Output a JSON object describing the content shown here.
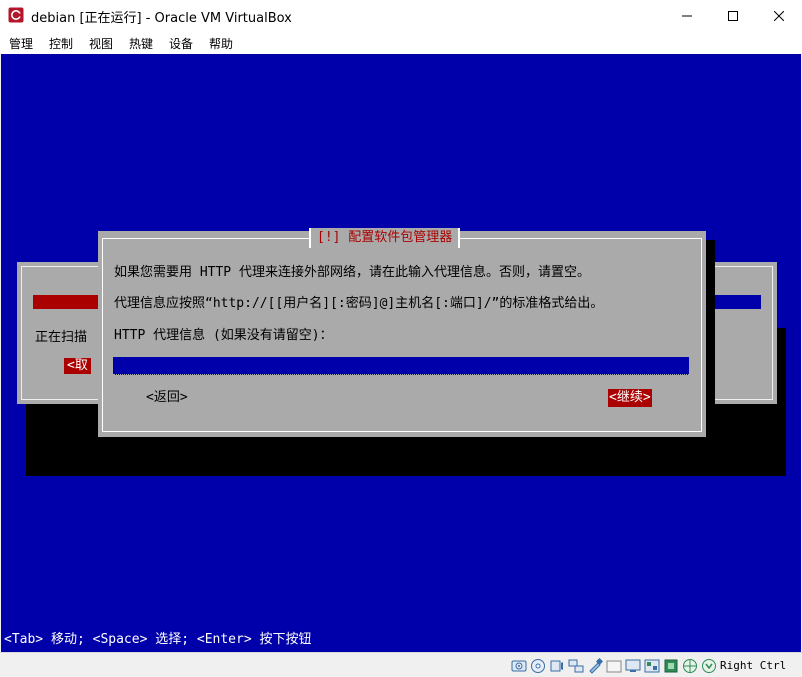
{
  "window": {
    "title": "debian [正在运行] - Oracle VM VirtualBox",
    "host_key": "Right Ctrl"
  },
  "menu": [
    "管理",
    "控制",
    "视图",
    "热键",
    "设备",
    "帮助"
  ],
  "background_dialog": {
    "status_text": "正在扫描",
    "cancel_label": "<取"
  },
  "dialog": {
    "title": "[!] 配置软件包管理器",
    "line1": "如果您需要用 HTTP 代理来连接外部网络，请在此输入代理信息。否则，请置空。",
    "line2": "代理信息应按照“http://[[用户名][:密码]@]主机名[:端口]/”的标准格式给出。",
    "input_label": "HTTP 代理信息 (如果没有请留空)：",
    "input_value": "",
    "back_label": "<返回>",
    "continue_label": "<继续>"
  },
  "hint": "<Tab> 移动; <Space> 选择; <Enter> 按下按钮",
  "colors": {
    "vm_background": "#0000aa",
    "dialog_gray": "#aaaaaa",
    "accent_red": "#aa0000"
  },
  "status_icons": [
    "hard-disk-icon",
    "optical-drive-icon",
    "audio-icon",
    "network-icon",
    "usb-icon",
    "shared-folder-icon",
    "display-icon",
    "video-capture-icon",
    "cpu-icon",
    "mouse-integration-icon",
    "keyboard-icon"
  ]
}
